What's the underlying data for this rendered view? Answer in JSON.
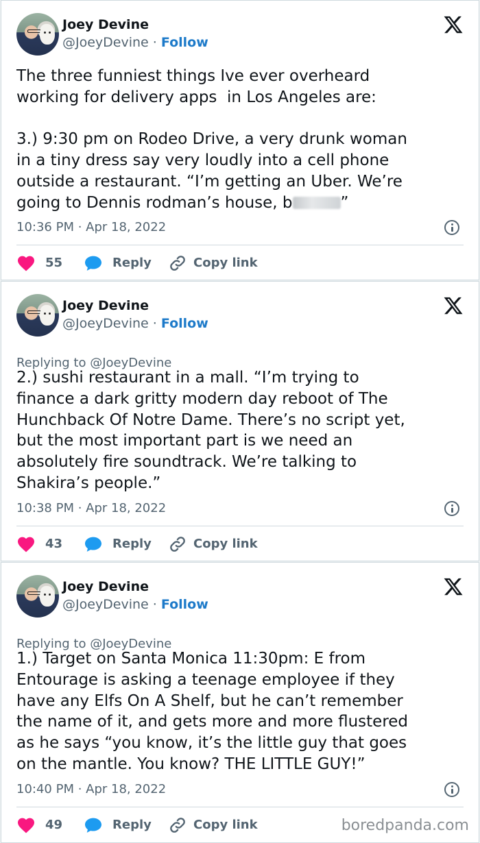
{
  "tweets": [
    {
      "author_name": "Joey Devine",
      "handle": "@JoeyDevine",
      "separator": "·",
      "follow_label": "Follow",
      "replying_to": "",
      "text": "The three funniest things Ive ever overheard\nworking for delivery apps  in Los Angeles are:\n\n3.) 9:30 pm on Rodeo Drive, a very drunk woman\nin a tiny dress say very loudly into a cell phone\noutside a restaurant. “I’m getting an Uber. We’re\ngoing to Dennis rodman’s house, b",
      "text_tail": "”",
      "timestamp": "10:36 PM · Apr 18, 2022",
      "likes": "55",
      "reply_label": "Reply",
      "copy_label": "Copy link"
    },
    {
      "author_name": "Joey Devine",
      "handle": "@JoeyDevine",
      "separator": "·",
      "follow_label": "Follow",
      "replying_to": "Replying to @JoeyDevine",
      "text": "2.) sushi restaurant in a mall. “I’m trying to\nfinance a dark gritty modern day reboot of The\nHunchback Of Notre Dame. There’s no script yet,\nbut the most important part is we need an\nabsolutely fire soundtrack. We’re talking to\nShakira’s people.”",
      "timestamp": "10:38 PM · Apr 18, 2022",
      "likes": "43",
      "reply_label": "Reply",
      "copy_label": "Copy link"
    },
    {
      "author_name": "Joey Devine",
      "handle": "@JoeyDevine",
      "separator": "·",
      "follow_label": "Follow",
      "replying_to": "Replying to @JoeyDevine",
      "text": "1.) Target on Santa Monica 11:30pm: E from\nEntourage is asking a teenage employee if they\nhave any Elfs On A Shelf, but he can’t remember\nthe name of it, and gets more and more flustered\nas he says “you know, it’s the little guy that goes\non the mantle. You know? THE LITTLE GUY!”",
      "timestamp": "10:40 PM · Apr 18, 2022",
      "likes": "49",
      "reply_label": "Reply",
      "copy_label": "Copy link"
    }
  ],
  "watermark": "boredpanda.com",
  "colors": {
    "heart": "#f91880",
    "bubble": "#1d9bf0",
    "follow": "#1d7ac9",
    "muted": "#536471"
  },
  "icons": [
    "x-logo-icon",
    "heart-icon",
    "reply-bubble-icon",
    "link-icon",
    "info-icon"
  ]
}
